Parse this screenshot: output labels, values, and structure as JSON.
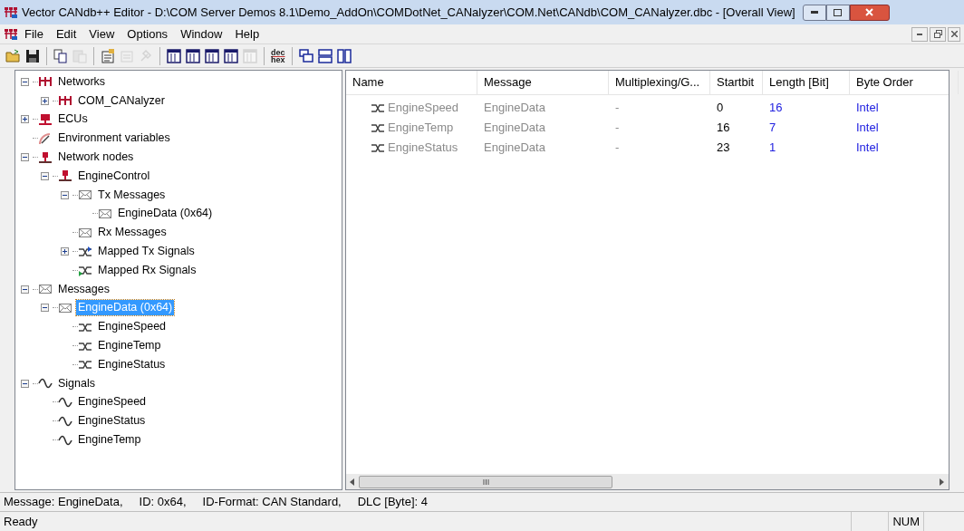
{
  "window": {
    "title": "Vector CANdb++ Editor - D:\\COM Server Demos 8.1\\Demo_AddOn\\COMDotNet_CANalyzer\\COM.Net\\CANdb\\COM_CANalyzer.dbc - [Overall View]"
  },
  "menu": [
    "File",
    "Edit",
    "View",
    "Options",
    "Window",
    "Help"
  ],
  "toolbar": [
    {
      "kind": "open",
      "disabled": false
    },
    {
      "kind": "save",
      "disabled": false
    },
    {
      "kind": "sep"
    },
    {
      "kind": "copy",
      "disabled": false
    },
    {
      "kind": "paste",
      "disabled": true
    },
    {
      "kind": "sep"
    },
    {
      "kind": "properties",
      "disabled": false
    },
    {
      "kind": "list",
      "disabled": true
    },
    {
      "kind": "tool",
      "disabled": true
    },
    {
      "kind": "sep"
    },
    {
      "kind": "view1",
      "disabled": false
    },
    {
      "kind": "view2",
      "disabled": false
    },
    {
      "kind": "view3",
      "disabled": false
    },
    {
      "kind": "view4",
      "disabled": false
    },
    {
      "kind": "view5",
      "disabled": true
    },
    {
      "kind": "sep"
    },
    {
      "kind": "dechex",
      "top": "dec",
      "bottom": "hex",
      "disabled": false
    },
    {
      "kind": "sep"
    },
    {
      "kind": "cascade",
      "disabled": false
    },
    {
      "kind": "tileh",
      "disabled": false
    },
    {
      "kind": "tilev",
      "disabled": false
    }
  ],
  "tree": [
    {
      "label": "Networks",
      "kind": "network",
      "expanded": true,
      "selected": false,
      "children": [
        {
          "label": "COM_CANalyzer",
          "kind": "network",
          "expanded": false,
          "selected": false
        }
      ]
    },
    {
      "label": "ECUs",
      "kind": "ecu",
      "expanded": false,
      "selected": false
    },
    {
      "label": "Environment variables",
      "kind": "envvar",
      "selected": false
    },
    {
      "label": "Network nodes",
      "kind": "node",
      "expanded": true,
      "selected": false,
      "children": [
        {
          "label": "EngineControl",
          "kind": "node",
          "expanded": true,
          "selected": false,
          "children": [
            {
              "label": "Tx Messages",
              "kind": "message",
              "expanded": true,
              "selected": false,
              "children": [
                {
                  "label": "EngineData (0x64)",
                  "kind": "message",
                  "selected": false
                }
              ]
            },
            {
              "label": "Rx Messages",
              "kind": "message",
              "selected": false
            },
            {
              "label": "Mapped Tx Signals",
              "kind": "mapped_tx",
              "expanded": false,
              "selected": false
            },
            {
              "label": "Mapped Rx Signals",
              "kind": "mapped_rx",
              "selected": false
            }
          ]
        }
      ]
    },
    {
      "label": "Messages",
      "kind": "message",
      "expanded": true,
      "selected": false,
      "children": [
        {
          "label": "EngineData (0x64)",
          "kind": "message",
          "expanded": true,
          "selected": true,
          "children": [
            {
              "label": "EngineSpeed",
              "kind": "msg_signal",
              "selected": false
            },
            {
              "label": "EngineTemp",
              "kind": "msg_signal",
              "selected": false
            },
            {
              "label": "EngineStatus",
              "kind": "msg_signal",
              "selected": false
            }
          ]
        }
      ]
    },
    {
      "label": "Signals",
      "kind": "signal",
      "expanded": true,
      "selected": false,
      "children": [
        {
          "label": "EngineSpeed",
          "kind": "signal",
          "selected": false
        },
        {
          "label": "EngineStatus",
          "kind": "signal",
          "selected": false
        },
        {
          "label": "EngineTemp",
          "kind": "signal",
          "selected": false
        }
      ]
    }
  ],
  "table": {
    "columns": [
      "Name",
      "Message",
      "Multiplexing/G...",
      "Startbit",
      "Length [Bit]",
      "Byte Order"
    ],
    "rows": [
      {
        "cells": [
          "EngineSpeed",
          "EngineData",
          "-",
          "0",
          "16",
          "Intel"
        ]
      },
      {
        "cells": [
          "EngineTemp",
          "EngineData",
          "-",
          "16",
          "7",
          "Intel"
        ]
      },
      {
        "cells": [
          "EngineStatus",
          "EngineData",
          "-",
          "23",
          "1",
          "Intel"
        ]
      }
    ]
  },
  "info_line": [
    "Message: EngineData,",
    "ID: 0x64,",
    "ID-Format: CAN Standard,",
    "DLC [Byte]: 4"
  ],
  "status_bar": {
    "text": "Ready",
    "indicators": [
      "NUM"
    ]
  }
}
